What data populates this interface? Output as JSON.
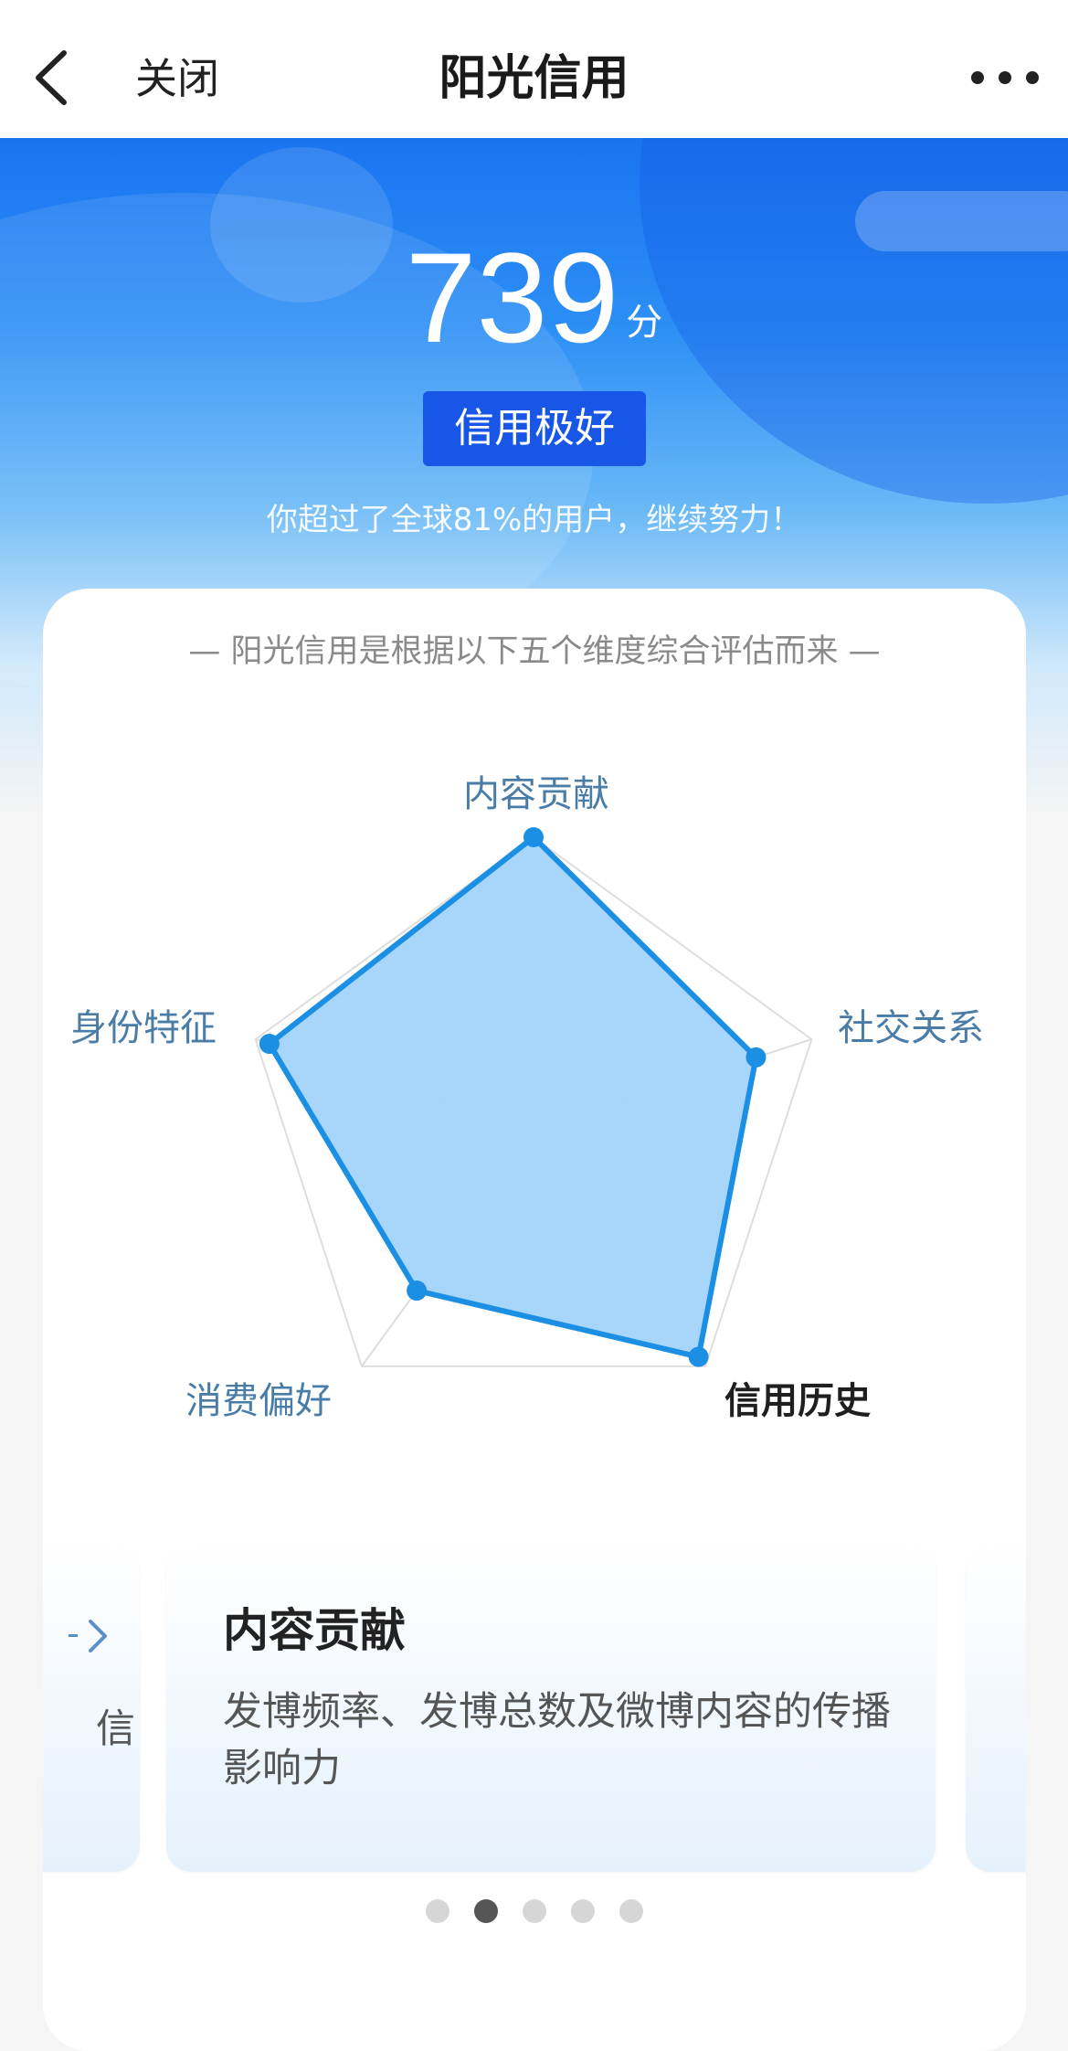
{
  "nav": {
    "close_label": "关闭",
    "title": "阳光信用"
  },
  "hero": {
    "score": "739",
    "score_unit": "分",
    "rating": "信用极好",
    "percentile_text": "你超过了全球81%的用户，继续努力！"
  },
  "card": {
    "subtitle": "— 阳光信用是根据以下五个维度综合评估而来 —"
  },
  "radar": {
    "dimensions": [
      {
        "label": "内容贡献",
        "value": 1.0
      },
      {
        "label": "社交关系",
        "value": 0.8
      },
      {
        "label": "信用历史",
        "value": 0.96
      },
      {
        "label": "消费偏好",
        "value": 0.68
      },
      {
        "label": "身份特征",
        "value": 0.95
      }
    ],
    "active_dimension": "信用历史",
    "colors": {
      "fill": "#a3d4fb",
      "stroke": "#1a8fe3",
      "grid": "#dddddd"
    }
  },
  "carousel": {
    "current_slide": {
      "title": "内容贡献",
      "description": "发博频率、发博总数及微博内容的传播影响力"
    },
    "prev_slide_fragment": "信",
    "dots": 5,
    "active_dot": 1
  },
  "icons": {
    "back": "chevron-left-icon",
    "more": "more-horizontal-icon",
    "prev": "chevron-right-icon"
  }
}
